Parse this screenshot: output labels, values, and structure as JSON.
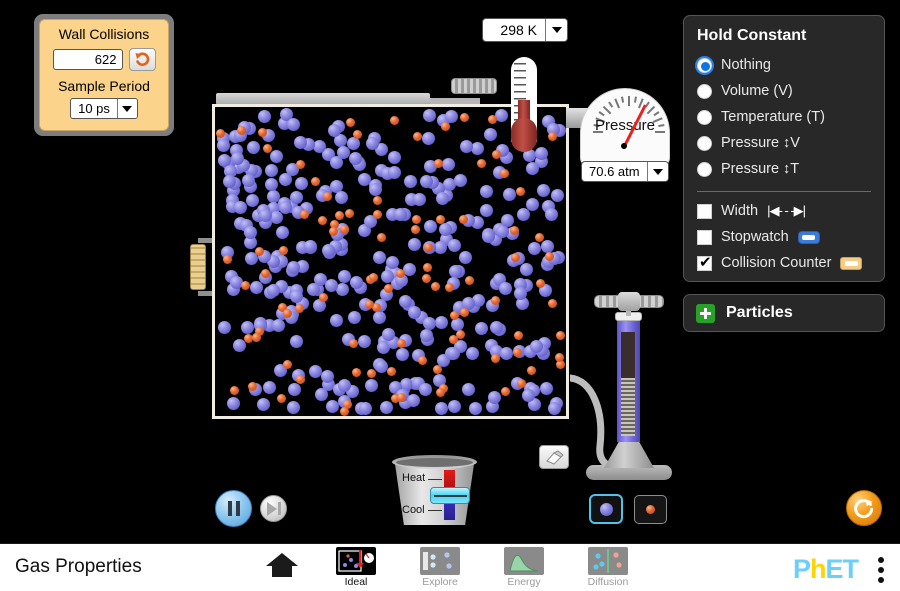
{
  "collision_counter": {
    "title": "Wall Collisions",
    "value": "622",
    "reset_icon": "undo-icon",
    "sample_period_label": "Sample Period",
    "sample_period_value": "10 ps"
  },
  "thermometer": {
    "value": "298 K",
    "icon": "chevron-down-icon"
  },
  "pressure_gauge": {
    "label": "Pressure",
    "value": "70.6 atm",
    "icon": "chevron-down-icon"
  },
  "hold_constant": {
    "title": "Hold Constant",
    "options": [
      {
        "label": "Nothing",
        "selected": true
      },
      {
        "label": "Volume (V)",
        "selected": false
      },
      {
        "label": "Temperature (T)",
        "selected": false
      },
      {
        "label": "Pressure ↕V",
        "selected": false
      },
      {
        "label": "Pressure ↕T",
        "selected": false
      }
    ],
    "checkboxes": [
      {
        "label": "Width",
        "checked": false,
        "icon": "width-arrows-icon"
      },
      {
        "label": "Stopwatch",
        "checked": false,
        "icon": "stopwatch-icon"
      },
      {
        "label": "Collision Counter",
        "checked": true,
        "icon": "collision-counter-icon"
      }
    ]
  },
  "particles_panel": {
    "label": "Particles",
    "expand_icon": "plus-icon"
  },
  "heater_cooler": {
    "heat_label": "Heat",
    "cool_label": "Cool"
  },
  "particle_type": {
    "heavy_selected": true,
    "light_selected": false,
    "heavy_name": "heavy-particle",
    "light_name": "light-particle"
  },
  "controls": {
    "pause_icon": "pause-icon",
    "step_icon": "step-forward-icon",
    "eraser_icon": "eraser-icon",
    "reset_all_icon": "reset-all-icon",
    "pump_icon": "bicycle-pump-icon"
  },
  "navbar": {
    "title": "Gas Properties",
    "home_icon": "home-icon",
    "kebab_icon": "kebab-menu-icon",
    "logo": {
      "part1": "P",
      "part2": "h",
      "part3": "ET"
    },
    "screens": [
      {
        "label": "Ideal",
        "active": true
      },
      {
        "label": "Explore",
        "active": false
      },
      {
        "label": "Energy",
        "active": false
      },
      {
        "label": "Diffusion",
        "active": false
      }
    ]
  },
  "colors": {
    "panel_bg": "#282828",
    "accent_blue": "#0d74e8",
    "counter_bg": "#fcd38a",
    "heavy_particle": "#8d8ae2",
    "light_particle": "#e2662c",
    "needle": "#ec2020",
    "reset_orange": "#f59b17",
    "particles_green": "#27a227"
  },
  "particles": {
    "heavy_count": 318,
    "light_count": 96
  }
}
